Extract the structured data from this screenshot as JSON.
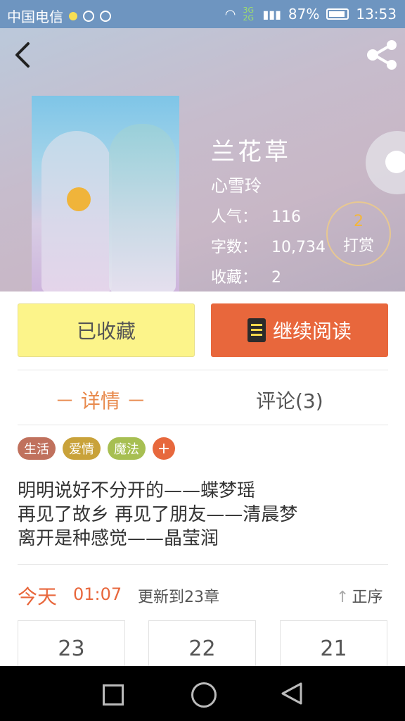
{
  "status_bar": {
    "carrier": "中国电信",
    "network": "3G 2G",
    "battery": "87%",
    "time": "13:53"
  },
  "book": {
    "title": "兰花草",
    "author": "心雪玲",
    "popularity_label": "人气：",
    "popularity": "116",
    "words_label": "字数：",
    "words": "10,734",
    "favorites_label": "收藏：",
    "favorites": "2"
  },
  "reward": {
    "count": "2",
    "label": "打赏"
  },
  "actions": {
    "favorited_label": "已收藏",
    "continue_label": "继续阅读"
  },
  "tabs": {
    "detail": "－  详情  －",
    "comments": "评论(3)"
  },
  "tags": [
    {
      "label": "生活",
      "color": "#c0715d"
    },
    {
      "label": "爱情",
      "color": "#c9a23a"
    },
    {
      "label": "魔法",
      "color": "#a7bf52"
    }
  ],
  "tag_add": "+",
  "description": [
    "明明说好不分开的——蝶梦瑶",
    "再见了故乡 再见了朋友——清晨梦",
    "离开是种感觉——晶莹润"
  ],
  "update": {
    "today": "今天",
    "time": "01:07",
    "text": "更新到23章",
    "order": "正序"
  },
  "chapters": [
    "23",
    "22",
    "21"
  ],
  "colors": {
    "accent": "#e8673c",
    "favorite": "#fcf48a",
    "status_bar": "#6e95c0"
  }
}
